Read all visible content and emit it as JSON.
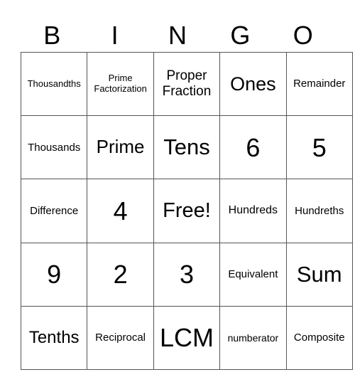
{
  "title_letters": [
    "B",
    "I",
    "N",
    "G",
    "O"
  ],
  "rows": [
    [
      "Thousandths",
      "Prime Factorization",
      "Proper Fraction",
      "Ones",
      "Remainder"
    ],
    [
      "Thousands",
      "Prime",
      "Tens",
      "6",
      "5"
    ],
    [
      "Difference",
      "4",
      "Free!",
      "Hundreds",
      "Hundreths"
    ],
    [
      "9",
      "2",
      "3",
      "Equivalent",
      "Sum"
    ],
    [
      "Tenths",
      "Reciprocal",
      "LCM",
      "numberator",
      "Composite"
    ]
  ]
}
